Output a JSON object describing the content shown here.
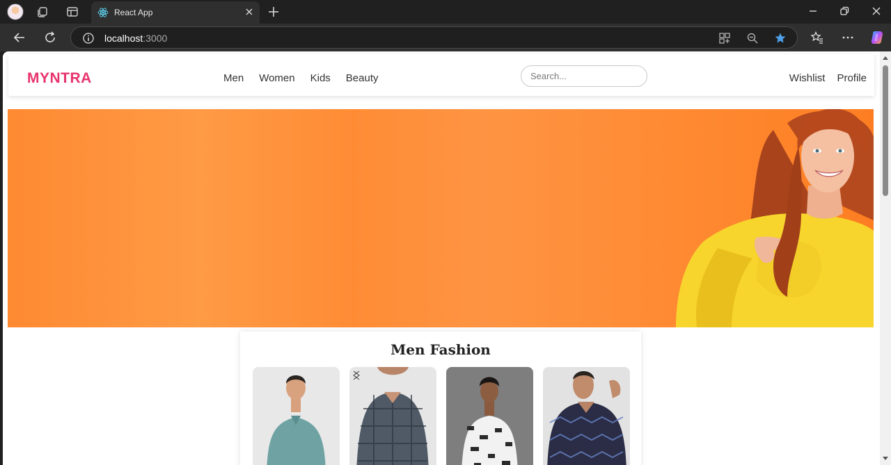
{
  "browser": {
    "tab_title": "React App",
    "url_host": "localhost",
    "url_port": ":3000"
  },
  "site": {
    "logo": "MYNTRA",
    "nav": [
      "Men",
      "Women",
      "Kids",
      "Beauty"
    ],
    "search_placeholder": "Search...",
    "right_nav": [
      "Wishlist",
      "Profile"
    ],
    "section_title": "Men Fashion",
    "products": [
      {
        "shirt_color": "#6fa3a3",
        "bg": "#e8e8e8"
      },
      {
        "shirt_color": "#4f5a66",
        "bg": "#e6e6e6"
      },
      {
        "shirt_color": "#f2f2f2",
        "bg": "#7e7e7e"
      },
      {
        "shirt_color": "#2a2d45",
        "bg": "#e2e2e2"
      }
    ],
    "brand_color": "#e8336d",
    "banner_color": "#fe8a32"
  }
}
